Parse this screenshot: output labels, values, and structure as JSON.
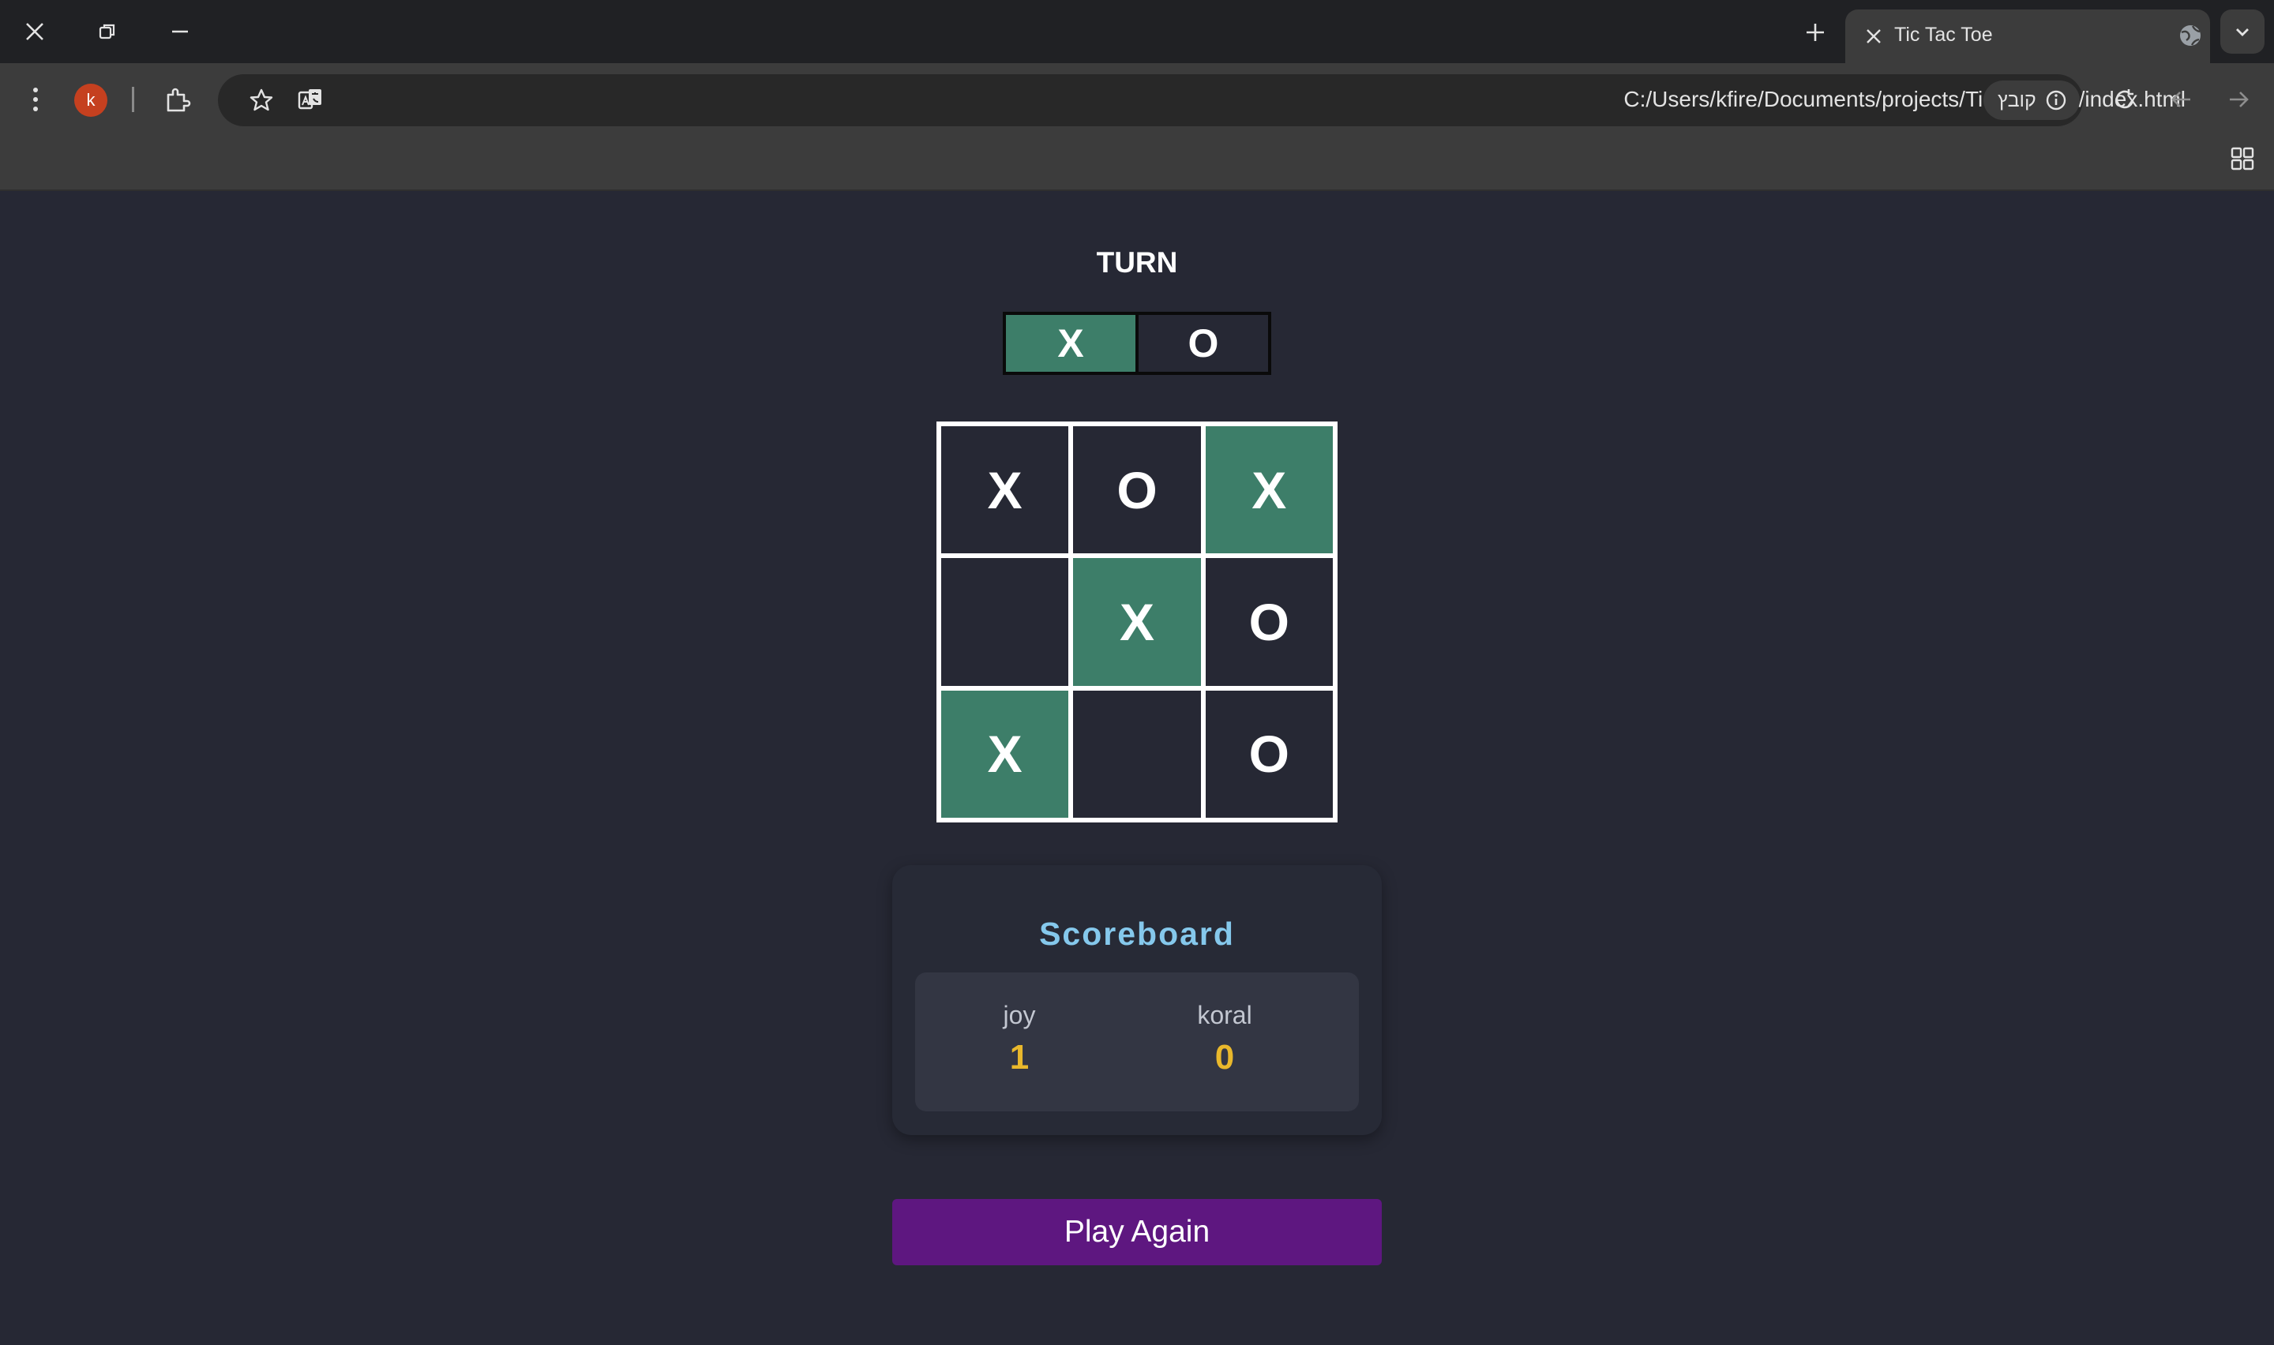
{
  "browser": {
    "tab_title": "Tic Tac Toe",
    "address": "C:/Users/kfire/Documents/projects/Tic-Tac-Toe/index.html",
    "site_chip_label": "קובץ",
    "profile_initial": "k",
    "profile_color": "#c5401f"
  },
  "game": {
    "turn_title": "TURN",
    "turn_players": [
      "X",
      "O"
    ],
    "active_turn": "X",
    "board": [
      "X",
      "O",
      "X",
      "",
      "X",
      "O",
      "X",
      "",
      "O"
    ],
    "winning_cells": [
      2,
      4,
      6
    ],
    "win_color": "#3d7e69"
  },
  "scoreboard": {
    "title": "Scoreboard",
    "players": [
      {
        "name": "joy",
        "score": "1"
      },
      {
        "name": "koral",
        "score": "0"
      }
    ]
  },
  "actions": {
    "play_again_label": "Play Again"
  },
  "colors": {
    "page_background": "#262834",
    "title_accent": "#85c8ec",
    "score_accent": "#e9b82c",
    "button": "#5e1780"
  }
}
